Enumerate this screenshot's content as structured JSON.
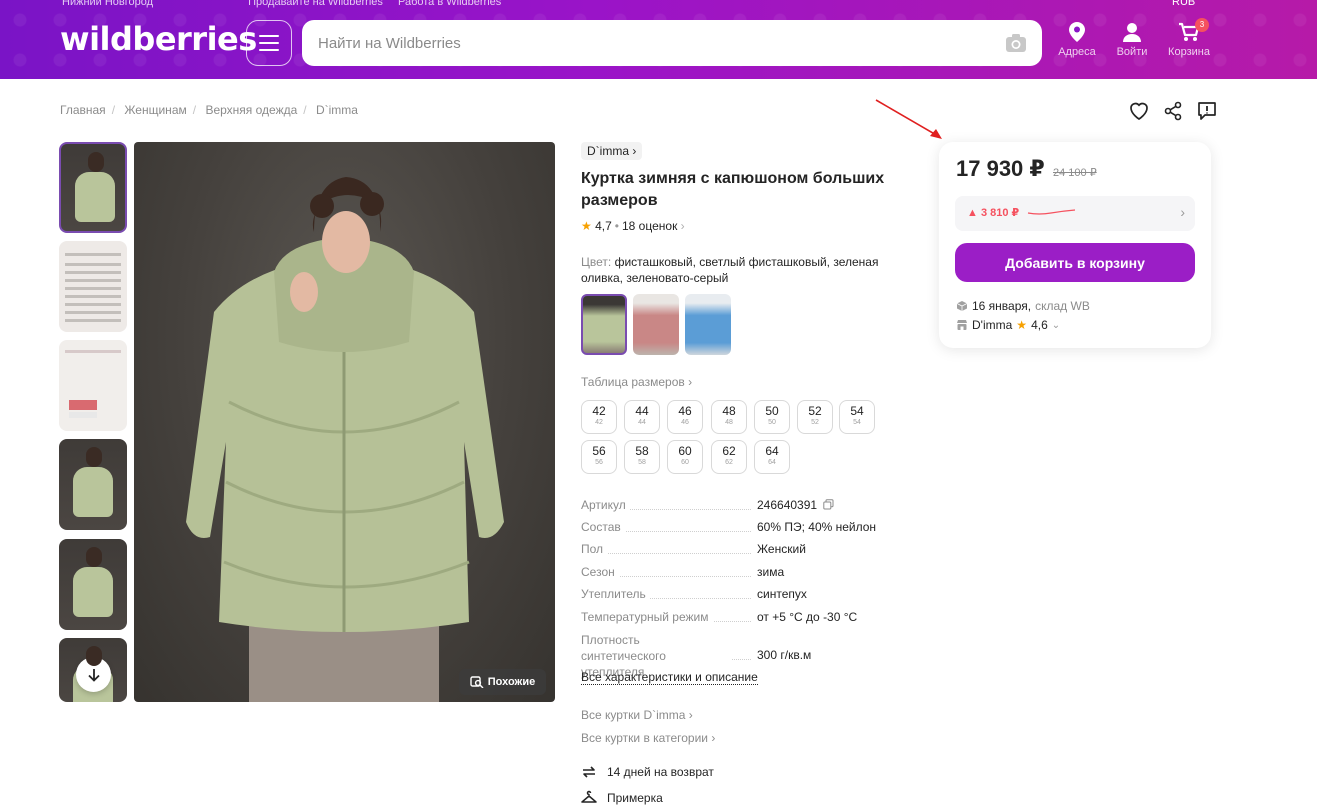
{
  "header": {
    "city": "Нижний Новгород",
    "link_sell": "Продавайте на Wildberries",
    "link_work": "Работа в Wildberries",
    "currency": "RUB",
    "logo": "wildberries",
    "search_placeholder": "Найти на Wildberries",
    "addresses_label": "Адреса",
    "login_label": "Войти",
    "cart_label": "Корзина",
    "cart_count": "3",
    "icons": [
      "menu-icon",
      "camera-icon",
      "location-pin-icon",
      "user-icon",
      "cart-icon"
    ]
  },
  "breadcrumb": [
    "Главная",
    "Женщинам",
    "Верхняя одежда",
    "D`imma"
  ],
  "top_icons": [
    "heart-icon",
    "share-icon",
    "report-icon"
  ],
  "gallery": {
    "similar_label": "Похожие"
  },
  "product": {
    "brand": "D`imma",
    "title": "Куртка зимняя с капюшоном больших размеров",
    "rating": "4,7",
    "reviews": "18 оценок",
    "color_label": "Цвет:",
    "color_value": "фисташковый, светлый фисташковый, зеленая оливка, зеленовато-серый",
    "swatch_colors": [
      "#b9c59b",
      "#c98786",
      "#5b9dd6"
    ],
    "sizes_link": "Таблица размеров",
    "sizes": [
      {
        "ru": "42",
        "eu": "42"
      },
      {
        "ru": "44",
        "eu": "44"
      },
      {
        "ru": "46",
        "eu": "46"
      },
      {
        "ru": "48",
        "eu": "48"
      },
      {
        "ru": "50",
        "eu": "50"
      },
      {
        "ru": "52",
        "eu": "52"
      },
      {
        "ru": "54",
        "eu": "54"
      },
      {
        "ru": "56",
        "eu": "56"
      },
      {
        "ru": "58",
        "eu": "58"
      },
      {
        "ru": "60",
        "eu": "60"
      },
      {
        "ru": "62",
        "eu": "62"
      },
      {
        "ru": "64",
        "eu": "64"
      }
    ],
    "specs": [
      {
        "k": "Артикул",
        "v": "246640391"
      },
      {
        "k": "Состав",
        "v": "60% ПЭ; 40% нейлон"
      },
      {
        "k": "Пол",
        "v": "Женский"
      },
      {
        "k": "Сезон",
        "v": "зима"
      },
      {
        "k": "Утеплитель",
        "v": "синтепух"
      },
      {
        "k": "Температурный режим",
        "v": "от +5 °C до -30 °C"
      },
      {
        "k": "Плотность синтетического утеплителя",
        "v": "300 г/кв.м"
      }
    ],
    "all_chars_link": "Все характеристики и описание",
    "brand_jackets_link": "Все куртки D`imma",
    "category_jackets_link": "Все куртки в категории",
    "return_label": "14 дней на возврат",
    "fitting_label": "Примерка"
  },
  "price_card": {
    "price": "17 930 ₽",
    "old_price": "24 100 ₽",
    "delta": "▲ 3 810 ₽",
    "add_to_cart": "Добавить в корзину",
    "delivery_date": "16 января,",
    "warehouse": "склад WB",
    "seller": "D'imma",
    "seller_rating": "4,6",
    "accent_color": "#9b1ec6",
    "delta_color": "#f5515f"
  }
}
